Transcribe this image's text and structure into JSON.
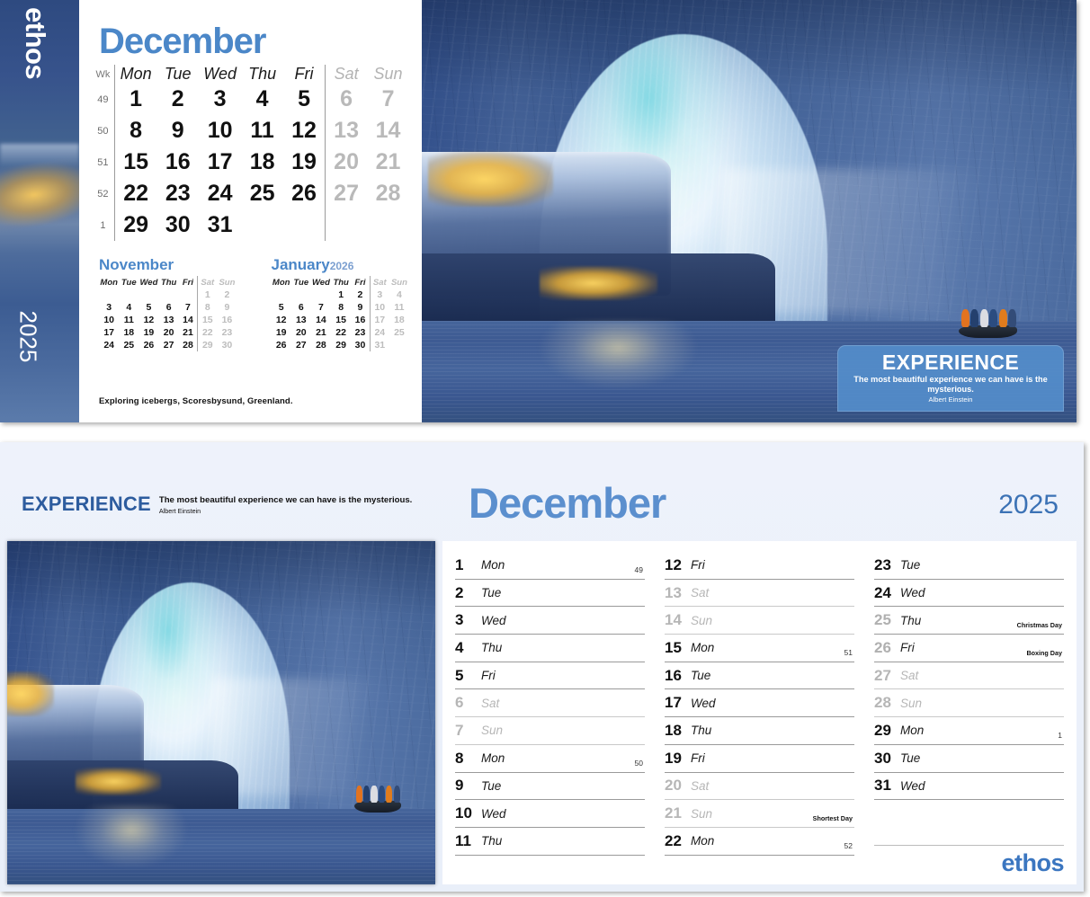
{
  "brand": {
    "name": "ethos",
    "year": "2025"
  },
  "top_panel": {
    "month_title": "December",
    "week_header": "Wk",
    "weekday_headers": [
      "Mon",
      "Tue",
      "Wed",
      "Thu",
      "Fri",
      "Sat",
      "Sun"
    ],
    "week_numbers": [
      "49",
      "50",
      "51",
      "52",
      "1"
    ],
    "grid_rows": [
      [
        "1",
        "2",
        "3",
        "4",
        "5",
        "6",
        "7"
      ],
      [
        "8",
        "9",
        "10",
        "11",
        "12",
        "13",
        "14"
      ],
      [
        "15",
        "16",
        "17",
        "18",
        "19",
        "20",
        "21"
      ],
      [
        "22",
        "23",
        "24",
        "25",
        "26",
        "27",
        "28"
      ],
      [
        "29",
        "30",
        "31",
        "",
        "",
        "",
        ""
      ]
    ],
    "caption": "Exploring icebergs, Scoresbysund, Greenland.",
    "mini_calendars": [
      {
        "name": "November",
        "year": "",
        "weekday_headers": [
          "Mon",
          "Tue",
          "Wed",
          "Thu",
          "Fri",
          "Sat",
          "Sun"
        ],
        "rows": [
          [
            "",
            "",
            "",
            "",
            "",
            "1",
            "2"
          ],
          [
            "3",
            "4",
            "5",
            "6",
            "7",
            "8",
            "9"
          ],
          [
            "10",
            "11",
            "12",
            "13",
            "14",
            "15",
            "16"
          ],
          [
            "17",
            "18",
            "19",
            "20",
            "21",
            "22",
            "23"
          ],
          [
            "24",
            "25",
            "26",
            "27",
            "28",
            "29",
            "30"
          ]
        ]
      },
      {
        "name": "January",
        "year": "2026",
        "weekday_headers": [
          "Mon",
          "Tue",
          "Wed",
          "Thu",
          "Fri",
          "Sat",
          "Sun"
        ],
        "rows": [
          [
            "",
            "",
            "",
            "1",
            "2",
            "3",
            "4"
          ],
          [
            "5",
            "6",
            "7",
            "8",
            "9",
            "10",
            "11"
          ],
          [
            "12",
            "13",
            "14",
            "15",
            "16",
            "17",
            "18"
          ],
          [
            "19",
            "20",
            "21",
            "22",
            "23",
            "24",
            "25"
          ],
          [
            "26",
            "27",
            "28",
            "29",
            "30",
            "31",
            ""
          ]
        ]
      }
    ],
    "banner": {
      "title": "EXPERIENCE",
      "quote": "The most beautiful experience we can have is the mysterious.",
      "author": "Albert Einstein"
    }
  },
  "bottom_panel": {
    "experience_title": "EXPERIENCE",
    "experience_quote": "The most beautiful experience we can have is the mysterious.",
    "experience_author": "Albert Einstein",
    "month_title": "December",
    "year": "2025",
    "logo": "ethos",
    "columns": [
      [
        {
          "num": "1",
          "dow": "Mon",
          "weekend": false,
          "wk": "49",
          "note": ""
        },
        {
          "num": "2",
          "dow": "Tue",
          "weekend": false,
          "wk": "",
          "note": ""
        },
        {
          "num": "3",
          "dow": "Wed",
          "weekend": false,
          "wk": "",
          "note": ""
        },
        {
          "num": "4",
          "dow": "Thu",
          "weekend": false,
          "wk": "",
          "note": ""
        },
        {
          "num": "5",
          "dow": "Fri",
          "weekend": false,
          "wk": "",
          "note": ""
        },
        {
          "num": "6",
          "dow": "Sat",
          "weekend": true,
          "wk": "",
          "note": ""
        },
        {
          "num": "7",
          "dow": "Sun",
          "weekend": true,
          "wk": "",
          "note": ""
        },
        {
          "num": "8",
          "dow": "Mon",
          "weekend": false,
          "wk": "50",
          "note": ""
        },
        {
          "num": "9",
          "dow": "Tue",
          "weekend": false,
          "wk": "",
          "note": ""
        },
        {
          "num": "10",
          "dow": "Wed",
          "weekend": false,
          "wk": "",
          "note": ""
        },
        {
          "num": "11",
          "dow": "Thu",
          "weekend": false,
          "wk": "",
          "note": ""
        }
      ],
      [
        {
          "num": "12",
          "dow": "Fri",
          "weekend": false,
          "wk": "",
          "note": ""
        },
        {
          "num": "13",
          "dow": "Sat",
          "weekend": true,
          "wk": "",
          "note": ""
        },
        {
          "num": "14",
          "dow": "Sun",
          "weekend": true,
          "wk": "",
          "note": ""
        },
        {
          "num": "15",
          "dow": "Mon",
          "weekend": false,
          "wk": "51",
          "note": ""
        },
        {
          "num": "16",
          "dow": "Tue",
          "weekend": false,
          "wk": "",
          "note": ""
        },
        {
          "num": "17",
          "dow": "Wed",
          "weekend": false,
          "wk": "",
          "note": ""
        },
        {
          "num": "18",
          "dow": "Thu",
          "weekend": false,
          "wk": "",
          "note": ""
        },
        {
          "num": "19",
          "dow": "Fri",
          "weekend": false,
          "wk": "",
          "note": ""
        },
        {
          "num": "20",
          "dow": "Sat",
          "weekend": true,
          "wk": "",
          "note": ""
        },
        {
          "num": "21",
          "dow": "Sun",
          "weekend": true,
          "wk": "",
          "note": "Shortest Day"
        },
        {
          "num": "22",
          "dow": "Mon",
          "weekend": false,
          "wk": "52",
          "note": ""
        }
      ],
      [
        {
          "num": "23",
          "dow": "Tue",
          "weekend": false,
          "wk": "",
          "note": ""
        },
        {
          "num": "24",
          "dow": "Wed",
          "weekend": false,
          "wk": "",
          "note": ""
        },
        {
          "num": "25",
          "dow": "Thu",
          "weekend": false,
          "holiday": true,
          "wk": "",
          "note": "Christmas Day"
        },
        {
          "num": "26",
          "dow": "Fri",
          "weekend": false,
          "holiday": true,
          "wk": "",
          "note": "Boxing Day"
        },
        {
          "num": "27",
          "dow": "Sat",
          "weekend": true,
          "wk": "",
          "note": ""
        },
        {
          "num": "28",
          "dow": "Sun",
          "weekend": true,
          "wk": "",
          "note": ""
        },
        {
          "num": "29",
          "dow": "Mon",
          "weekend": false,
          "wk": "1",
          "note": ""
        },
        {
          "num": "30",
          "dow": "Tue",
          "weekend": false,
          "wk": "",
          "note": ""
        },
        {
          "num": "31",
          "dow": "Wed",
          "weekend": false,
          "wk": "",
          "note": ""
        }
      ]
    ]
  }
}
